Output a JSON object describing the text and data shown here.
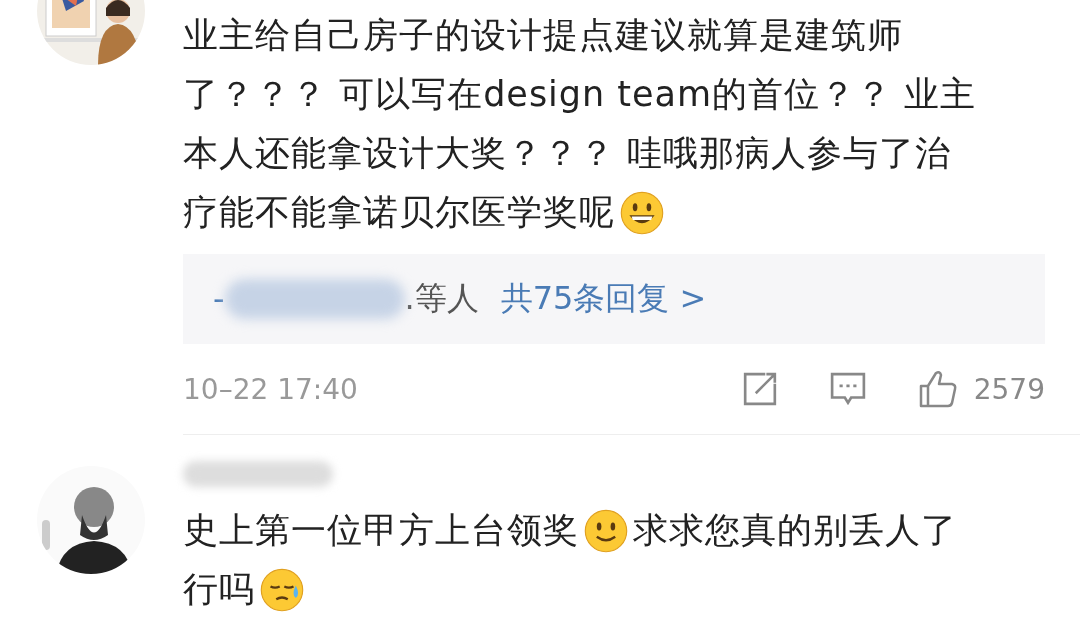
{
  "comments": [
    {
      "avatar": {
        "kind": "picture"
      },
      "blurred_name": false,
      "lines": [
        [
          {
            "kind": "text",
            "text": "业主给自己房子的设计提点建议就算是建筑师"
          }
        ],
        [
          {
            "kind": "text",
            "text": "了？？？ 可以写在design team的首位？？ 业主"
          }
        ],
        [
          {
            "kind": "text",
            "text": "本人还能拿设计大奖？？？ 哇哦那病人参与了治"
          }
        ],
        [
          {
            "kind": "text",
            "text": "疗能不能拿诺贝尔医学奖呢"
          },
          {
            "kind": "grin"
          }
        ]
      ],
      "replies": {
        "author_prefix": "-",
        "author_blurred": true,
        "suffix": ".等人",
        "link": "共75条回复 >"
      },
      "time": "10–22 17:40",
      "likes": "2579"
    },
    {
      "avatar": {
        "kind": "picture"
      },
      "blurred_name": true,
      "lines": [
        [
          {
            "kind": "text",
            "text": "史上第一位甲方上台领奖"
          },
          {
            "kind": "smile"
          },
          {
            "kind": "text",
            "text": "求求您真的别丢人了"
          }
        ],
        [
          {
            "kind": "text",
            "text": "行吗"
          },
          {
            "kind": "sweat"
          }
        ]
      ]
    }
  ]
}
